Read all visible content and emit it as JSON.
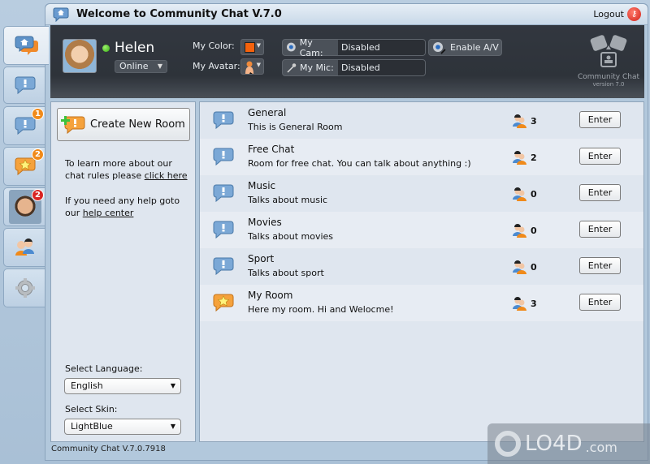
{
  "window": {
    "title": "Welcome to Community Chat V.7.0",
    "logout_label": "Logout",
    "footer_version": "Community Chat V.7.0.7918"
  },
  "rail": {
    "tabs": [
      {
        "name": "home",
        "icon": "home-chat-icon",
        "active": true,
        "badge": null
      },
      {
        "name": "rooms",
        "icon": "chat-bubble-icon",
        "badge": null
      },
      {
        "name": "messages",
        "icon": "chat-bubble-icon",
        "badge": "1"
      },
      {
        "name": "favorites",
        "icon": "star-bubble-icon",
        "badge": "2"
      },
      {
        "name": "contact",
        "icon": "avatar-photo",
        "badge": "2"
      },
      {
        "name": "users",
        "icon": "users-icon",
        "badge": null
      },
      {
        "name": "settings",
        "icon": "gear-icon",
        "badge": null
      }
    ]
  },
  "header": {
    "username": "Helen",
    "status": "Online",
    "my_color_label": "My Color:",
    "my_color": "#f5620c",
    "my_avatar_label": "My Avatar:",
    "my_cam_label": "My Cam:",
    "my_cam_value": "Disabled",
    "my_mic_label": "My Mic:",
    "my_mic_value": "Disabled",
    "enable_av_label": "Enable A/V",
    "logo_title": "Community Chat",
    "logo_version": "version 7.0"
  },
  "left_panel": {
    "create_room_label": "Create New Room",
    "rules_text": "To learn more about our chat rules please ",
    "rules_link": "click here",
    "help_text": "If you need any help goto our ",
    "help_link": "help center",
    "language_label": "Select Language:",
    "language_value": "English",
    "skin_label": "Select Skin:",
    "skin_value": "LightBlue"
  },
  "rooms": [
    {
      "name": "General",
      "description": "This is General Room",
      "users": "3",
      "icon": "chat-bubble-icon",
      "enter_label": "Enter"
    },
    {
      "name": "Free Chat",
      "description": "Room for free chat. You can talk about anything :)",
      "users": "2",
      "icon": "chat-bubble-icon",
      "enter_label": "Enter"
    },
    {
      "name": "Music",
      "description": "Talks about music",
      "users": "0",
      "icon": "chat-bubble-icon",
      "enter_label": "Enter"
    },
    {
      "name": "Movies",
      "description": "Talks about movies",
      "users": "0",
      "icon": "chat-bubble-icon",
      "enter_label": "Enter"
    },
    {
      "name": "Sport",
      "description": "Talks about sport",
      "users": "0",
      "icon": "chat-bubble-icon",
      "enter_label": "Enter"
    },
    {
      "name": "My Room",
      "description": "Here my room. Hi and Welocme!",
      "users": "3",
      "icon": "star-bubble-icon",
      "enter_label": "Enter"
    }
  ],
  "watermark": {
    "text": "LO4D",
    "suffix": ".com"
  }
}
